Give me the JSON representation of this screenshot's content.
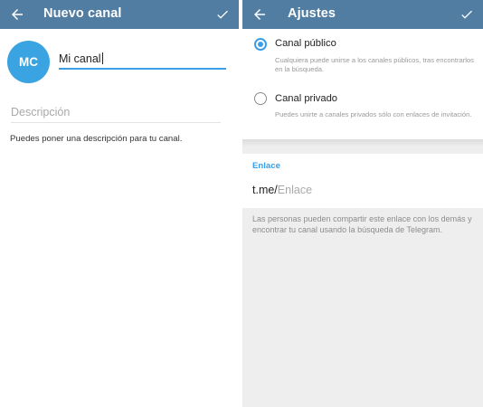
{
  "left": {
    "header": {
      "title": "Nuevo canal"
    },
    "avatar": {
      "initials": "MC"
    },
    "name": {
      "value": "Mi canal"
    },
    "description": {
      "placeholder": "Descripción",
      "help": "Puedes poner una descripción para tu canal."
    }
  },
  "right": {
    "header": {
      "title": "Ajustes"
    },
    "options": [
      {
        "title": "Canal público",
        "desc": "Cualquiera puede unirse a los canales públicos, tras encontrarlos en la búsqueda.",
        "selected": true
      },
      {
        "title": "Canal privado",
        "desc": "Puedes unirte a canales privados sólo con enlaces de invitación.",
        "selected": false
      }
    ],
    "link": {
      "label": "Enlace",
      "prefix": "t.me/",
      "placeholder": "Enlace",
      "help": "Las personas pueden compartir este enlace con los demás y encontrar tu canal usando la búsqueda de Telegram."
    }
  },
  "colors": {
    "appbar": "#517da2",
    "accent": "#3d9ee8",
    "avatar": "#3aa3e2"
  },
  "icons": {
    "back": "arrow-left",
    "confirm": "checkmark"
  }
}
